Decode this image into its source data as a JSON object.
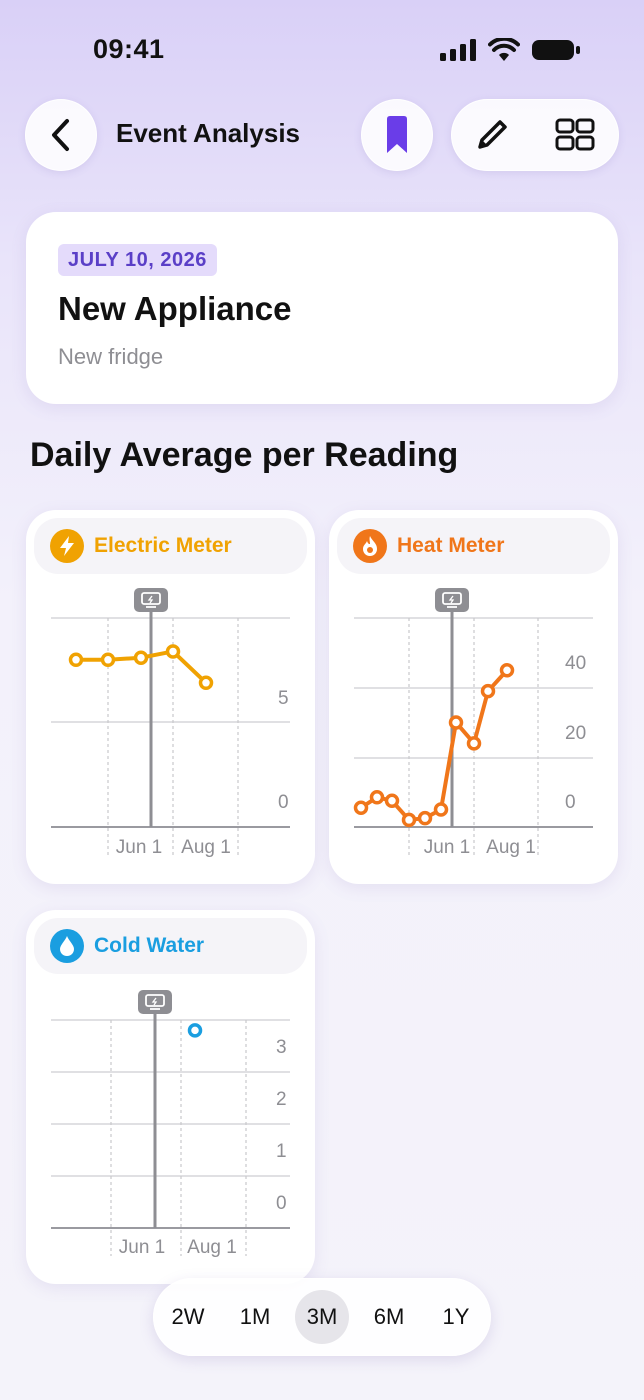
{
  "status": {
    "time": "09:41"
  },
  "nav": {
    "back_icon": "chevron-left-icon",
    "title": "Event Analysis",
    "bookmark_icon": "bookmark-icon",
    "edit_icon": "pencil-icon",
    "grid_icon": "grid-icon",
    "accent": "#6a3de8"
  },
  "event": {
    "date": "JULY 10, 2026",
    "title": "New Appliance",
    "subtitle": "New fridge"
  },
  "section_title": "Daily Average per Reading",
  "chart_data": [
    {
      "type": "line",
      "title": "Electric Meter",
      "color": "#f0a202",
      "icon": "bolt-icon",
      "x_tick_labels": [
        "Jun 1",
        "Aug 1"
      ],
      "y_tick_labels": [
        "5",
        "0"
      ],
      "ylim": [
        0,
        10
      ],
      "series": [
        {
          "values": [
            8.0,
            8.0,
            8.1,
            8.4,
            6.9
          ]
        }
      ],
      "event_marker": "between Jun 1 and Aug 1",
      "grid": true
    },
    {
      "type": "line",
      "title": "Heat Meter",
      "color": "#f0761a",
      "icon": "flame-icon",
      "x_tick_labels": [
        "Jun 1",
        "Aug 1"
      ],
      "y_tick_labels": [
        "40",
        "20",
        "0"
      ],
      "ylim": [
        -10,
        50
      ],
      "series": [
        {
          "values": [
            -0.5,
            2.5,
            1.5,
            -4,
            -3.5,
            -1,
            24,
            18,
            33,
            39
          ]
        }
      ],
      "event_marker": "at Jun 1",
      "grid": true
    },
    {
      "type": "scatter",
      "title": "Cold Water",
      "color": "#1a9ee0",
      "icon": "droplet-icon",
      "x_tick_labels": [
        "Jun 1",
        "Aug 1"
      ],
      "y_tick_labels": [
        "3",
        "2",
        "1",
        "0"
      ],
      "ylim": [
        0,
        4
      ],
      "series": [
        {
          "values": [
            3.8
          ]
        }
      ],
      "event_marker": "after Jun 1",
      "grid": true
    }
  ],
  "range": {
    "options": [
      "2W",
      "1M",
      "3M",
      "6M",
      "1Y"
    ],
    "selected": "3M"
  }
}
